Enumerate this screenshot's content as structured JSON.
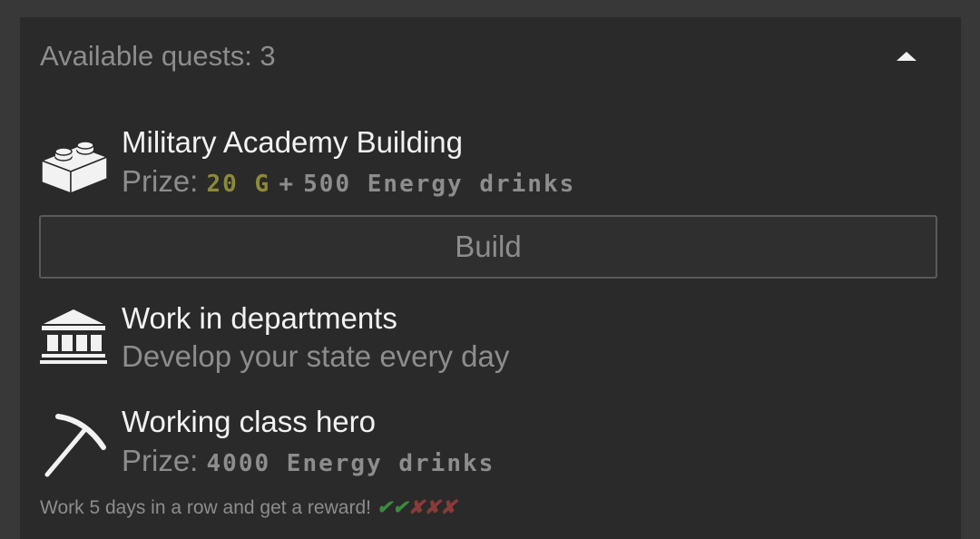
{
  "header": {
    "title": "Available quests: 3"
  },
  "quests": [
    {
      "icon": "lego-brick-icon",
      "title": "Military Academy Building",
      "prize_label": "Prize:",
      "prize_gold": "20 G",
      "prize_plus": "+",
      "prize_energy": "500 Energy drinks",
      "button_label": "Build"
    },
    {
      "icon": "government-building-icon",
      "title": "Work in departments",
      "description": "Develop your state every day"
    },
    {
      "icon": "pickaxe-icon",
      "title": "Working class hero",
      "prize_label": "Prize:",
      "prize_energy": "4000 Energy drinks",
      "streak_text": "Work 5 days in a row and get a reward!",
      "streak_done": "✔✔",
      "streak_todo": "✘✘✘"
    }
  ],
  "colors": {
    "panel_bg": "#2a2a2a",
    "page_bg": "#383838",
    "title_text": "#f2f2f2",
    "muted_text": "#8d8d8d",
    "gold": "#8c8a39",
    "check_green": "#3c8a3c",
    "cross_red": "#8a3a3a"
  }
}
